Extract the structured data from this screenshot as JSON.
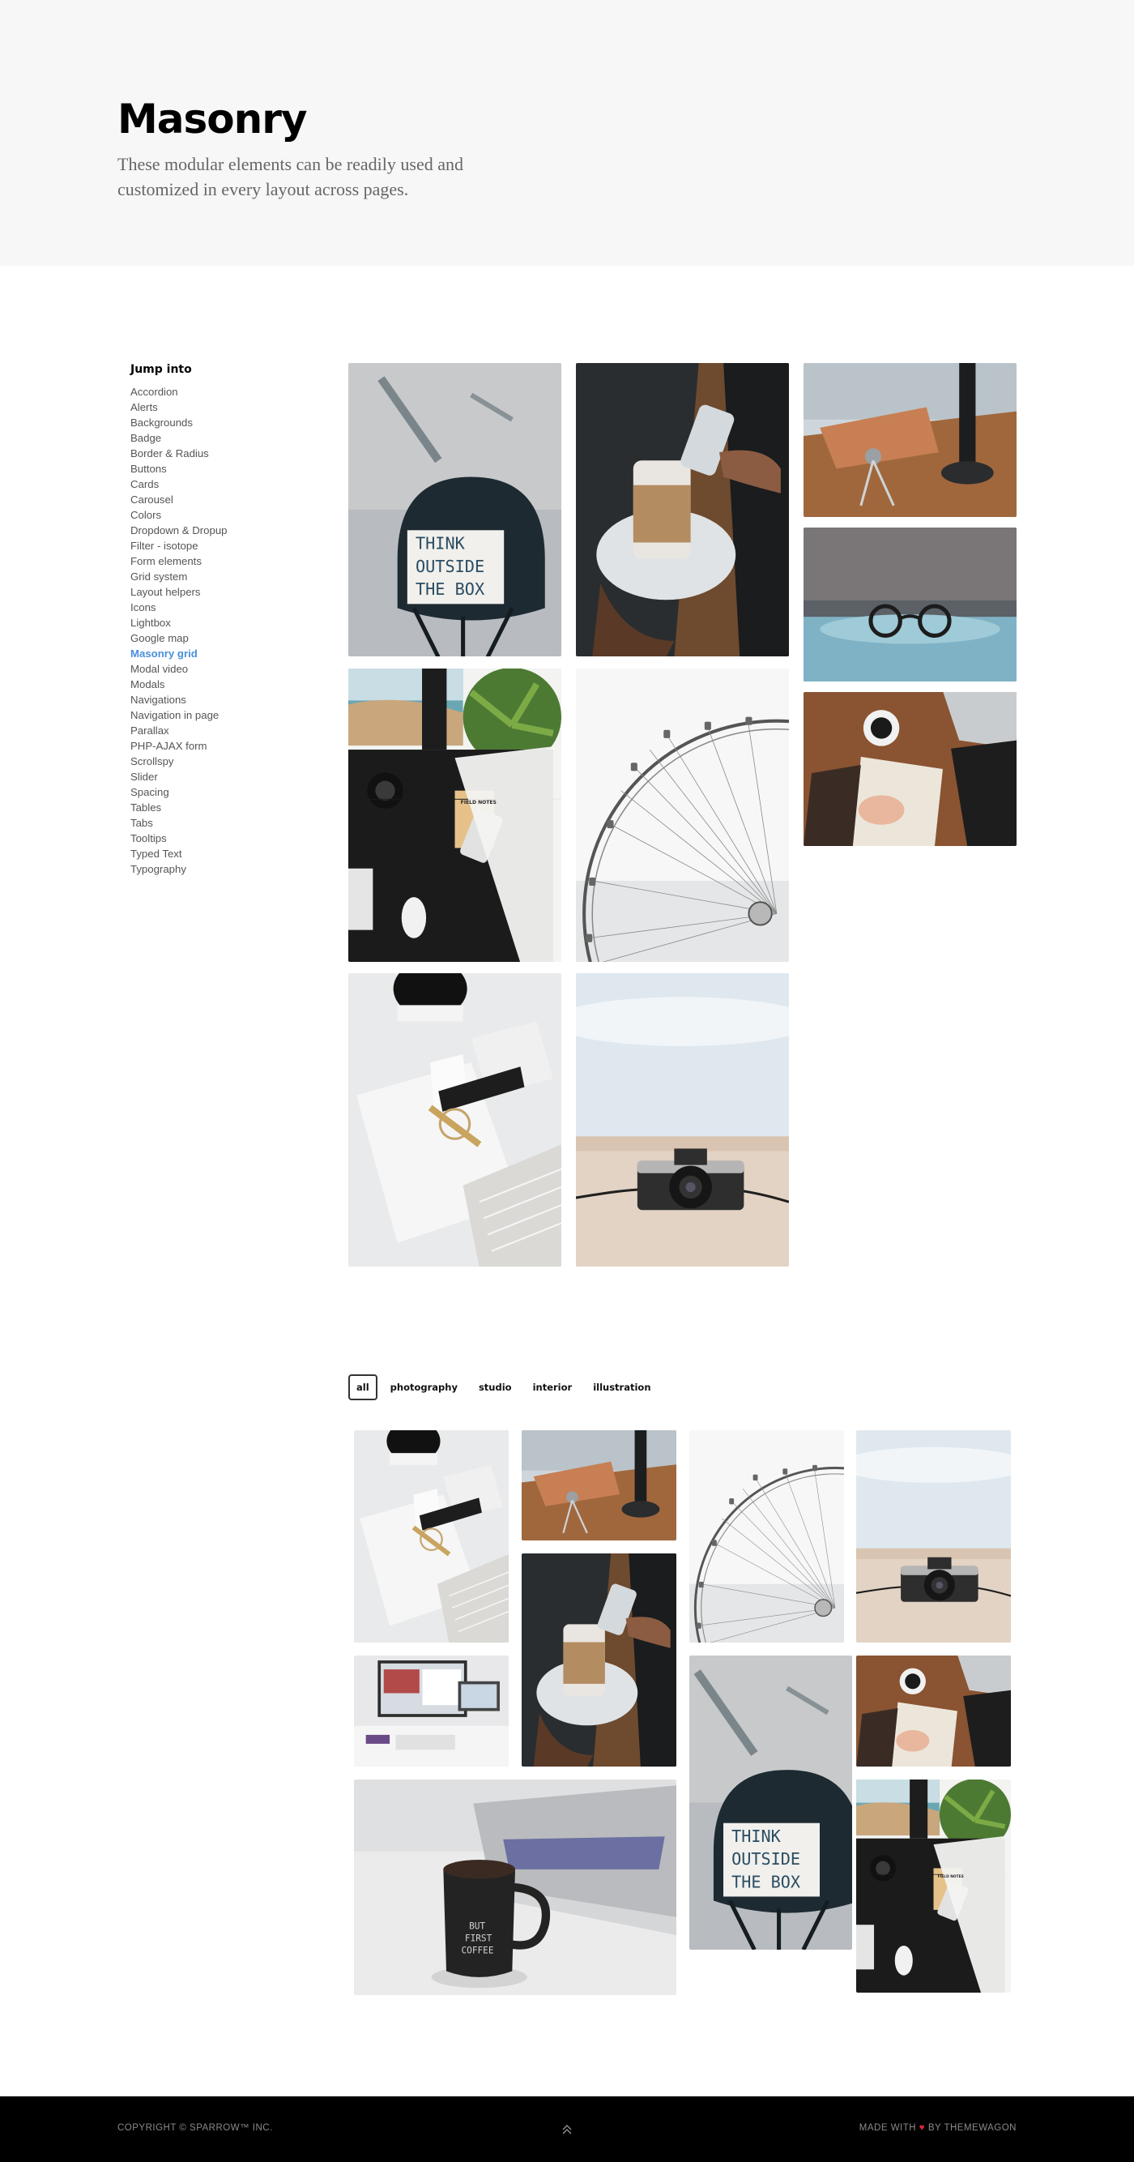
{
  "hero": {
    "title": "Masonry",
    "subtitle": "These modular elements can be readily used and customized in every layout across pages."
  },
  "sidebar": {
    "heading": "Jump into",
    "items": [
      "Accordion",
      "Alerts",
      "Backgrounds",
      "Badge",
      "Border & Radius",
      "Buttons",
      "Cards",
      "Carousel",
      "Colors",
      "Dropdown & Dropup",
      "Filter - isotope",
      "Form elements",
      "Grid system",
      "Layout helpers",
      "Icons",
      "Lightbox",
      "Google map",
      "Masonry grid",
      "Modal video",
      "Modals",
      "Navigations",
      "Navigation in page",
      "Parallax",
      "PHP-AJAX form",
      "Scrollspy",
      "Slider",
      "Spacing",
      "Tables",
      "Tabs",
      "Tooltips",
      "Typed Text",
      "Typography"
    ],
    "active_item": "Masonry grid"
  },
  "lightbox_sign": {
    "line1": "THINK",
    "line2": "OUTSIDE",
    "line3": "THE  BOX"
  },
  "notebook_label": "FIELD NOTES",
  "mug_text": {
    "line1": "BUT",
    "line2": "FIRST",
    "line3": "COFFEE"
  },
  "filters": [
    "all",
    "photography",
    "studio",
    "interior",
    "illustration"
  ],
  "active_filter": "all",
  "footer": {
    "copyright": "COPYRIGHT © SPARROW™ INC.",
    "made_with_prefix": "MADE WITH",
    "heart": "♥",
    "made_with_suffix": "BY THEMEWAGON"
  },
  "colors": {
    "accent": "#4a90d9",
    "heart": "#e0263e",
    "footer_bg": "#000000",
    "hero_bg": "#f7f7f7"
  }
}
